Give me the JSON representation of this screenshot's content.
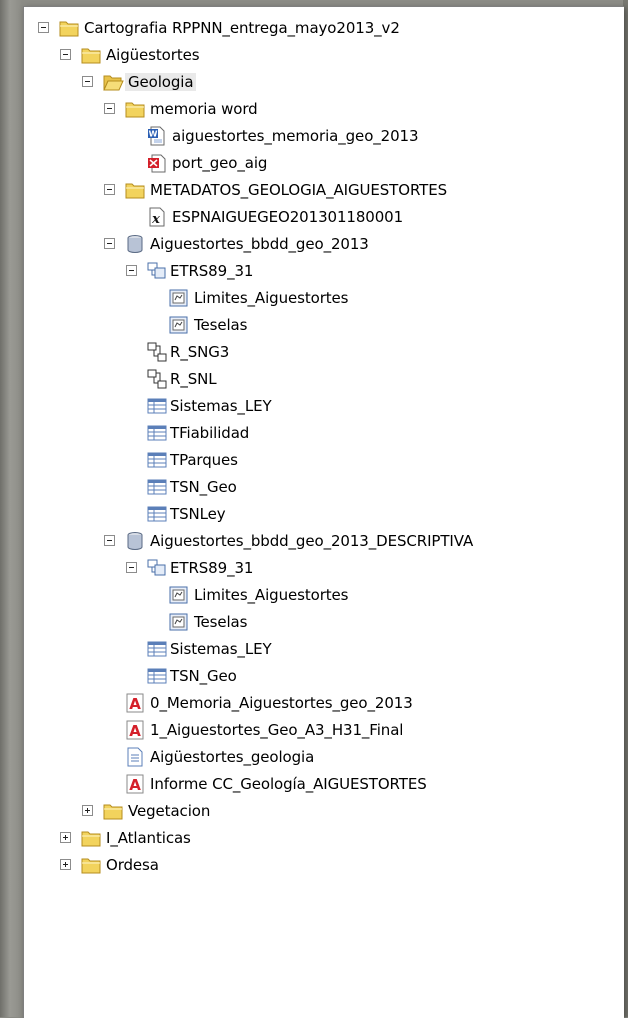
{
  "tree": {
    "root": "Cartografia RPPNN_entrega_mayo2013_v2",
    "aiguestortes": "Aigüestortes",
    "geologia": "Geologia",
    "memoria_word": "memoria word",
    "aig_memoria": "aiguestortes_memoria_geo_2013",
    "port_geo": "port_geo_aig",
    "metadatos": "METADATOS_GEOLOGIA_AIGUESTORTES",
    "espn": "ESPNAIGUEGEO201301180001",
    "bbdd1": "Aiguestortes_bbdd_geo_2013",
    "etrs1": "ETRS89_31",
    "limites1": "Limites_Aiguestortes",
    "teselas1": "Teselas",
    "rsng3": "R_SNG3",
    "rsnl": "R_SNL",
    "sistemas1": "Sistemas_LEY",
    "tfiab": "TFiabilidad",
    "tparq": "TParques",
    "tsngeo1": "TSN_Geo",
    "tsnley": "TSNLey",
    "bbdd2": "Aiguestortes_bbdd_geo_2013_DESCRIPTIVA",
    "etrs2": "ETRS89_31",
    "limites2": "Limites_Aiguestortes",
    "teselas2": "Teselas",
    "sistemas2": "Sistemas_LEY",
    "tsngeo2": "TSN_Geo",
    "pdf0": "0_Memoria_Aiguestortes_geo_2013",
    "pdf1": "1_Aiguestortes_Geo_A3_H31_Final",
    "aig_geologia": "Aigüestortes_geologia",
    "informe": "Informe CC_Geología_AIGUESTORTES",
    "vegetacion": "Vegetacion",
    "iatlanticas": "I_Atlanticas",
    "ordesa": "Ordesa"
  },
  "colors": {
    "folder": "#f2d35d",
    "folder_border": "#b58d1e",
    "selected_bg": "#e9e9e9",
    "pdf_red": "#d4202a",
    "table_blue": "#5b7fb8"
  }
}
